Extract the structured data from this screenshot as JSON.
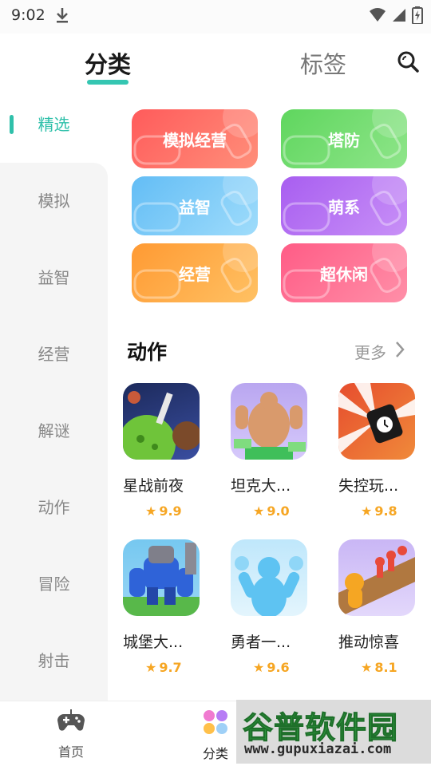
{
  "status_bar": {
    "time": "9:02"
  },
  "top_tabs": {
    "active": "分类",
    "inactive": "标签"
  },
  "sidebar": {
    "items": [
      {
        "label": "精选"
      },
      {
        "label": "模拟"
      },
      {
        "label": "益智"
      },
      {
        "label": "经营"
      },
      {
        "label": "解谜"
      },
      {
        "label": "动作"
      },
      {
        "label": "冒险"
      },
      {
        "label": "射击"
      }
    ]
  },
  "categories": [
    {
      "label": "模拟经营",
      "color": "#ff6a6a"
    },
    {
      "label": "塔防",
      "color": "#6bd96a"
    },
    {
      "label": "益智",
      "color": "#6ec6f5"
    },
    {
      "label": "萌系",
      "color": "#b36ef0"
    },
    {
      "label": "经营",
      "color": "#ffa640"
    },
    {
      "label": "超休闲",
      "color": "#ff6a8e"
    }
  ],
  "section": {
    "title": "动作",
    "more": "更多"
  },
  "games": [
    {
      "name": "星战前夜",
      "rating": "9.9"
    },
    {
      "name": "坦克大...",
      "rating": "9.0"
    },
    {
      "name": "失控玩...",
      "rating": "9.8"
    },
    {
      "name": "城堡大...",
      "rating": "9.7"
    },
    {
      "name": "勇者一...",
      "rating": "9.6"
    },
    {
      "name": "推动惊喜",
      "rating": "8.1"
    }
  ],
  "bottom_nav": {
    "home": "首页",
    "category": "分类"
  },
  "watermark": {
    "title": "谷普软件园",
    "url": "www.gupuxiazai.com"
  },
  "colors": {
    "accent": "#2fc0aa",
    "rating": "#f6a623"
  }
}
